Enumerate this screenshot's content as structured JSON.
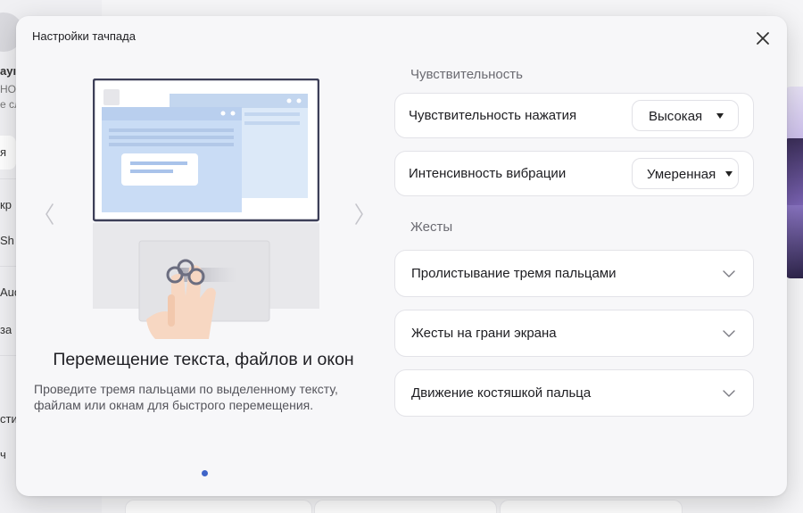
{
  "background": {
    "sidebar_fragments": [
      "ayı",
      "HON",
      "е сл",
      "я",
      "кр",
      "Sh",
      "Aud",
      "за",
      "сти",
      "ч"
    ]
  },
  "dialog": {
    "title": "Настройки тачпада"
  },
  "icons": {
    "close": "close-icon",
    "prev": "chevron-left-icon",
    "next": "chevron-right-icon",
    "expand": "chevron-down-icon"
  },
  "carousel": {
    "feature_title": "Перемещение текста, файлов и окон",
    "feature_desc": "Проведите тремя пальцами по выделенному тексту, файлам или окнам для быстрого перемещения.",
    "page_index": 1,
    "page_count": 1
  },
  "sensitivity": {
    "section_label": "Чувствительность",
    "press": {
      "label": "Чувствительность нажатия",
      "value": "Высокая"
    },
    "vibration": {
      "label": "Интенсивность вибрации",
      "value": "Умеренная"
    }
  },
  "gestures": {
    "section_label": "Жесты",
    "items": [
      {
        "label": "Пролистывание тремя пальцами"
      },
      {
        "label": "Жесты на грани экрана"
      },
      {
        "label": "Движение костяшкой пальца"
      }
    ]
  },
  "colors": {
    "accent": "#3f64c8",
    "dialog_bg": "#f7f7f9",
    "window_blue": "#c9dcf5"
  }
}
